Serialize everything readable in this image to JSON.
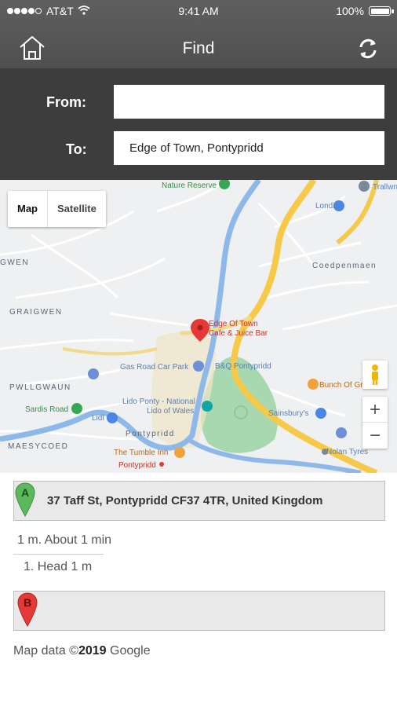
{
  "status_bar": {
    "carrier": "AT&T",
    "time": "9:41 AM",
    "battery": "100%"
  },
  "header": {
    "title": "Find",
    "home_icon": "home-icon",
    "refresh_icon": "refresh-icon"
  },
  "form": {
    "from_label": "From:",
    "from_value": "",
    "to_label": "To:",
    "to_value": "Edge of Town, Pontypridd"
  },
  "map": {
    "type_buttons": {
      "map": "Map",
      "satellite": "Satellite"
    },
    "zoom_in": "+",
    "zoom_out": "−",
    "labels": {
      "nature_reserve": "Nature Reserve",
      "trallwn": "Trallwn",
      "londis": "Londis",
      "coedpenmaen": "Coedpenmaen",
      "gwen": "GWEN",
      "graigwen": "GRAIGWEN",
      "pwllgwaun": "PWLLGWAUN",
      "maesycoed": "MAESYCOED",
      "edge_of_town_1": "Edge Of Town",
      "edge_of_town_2": "Cafe & Juice Bar",
      "gas_road": "Gas Road Car Park",
      "bq": "B&Q Pontypridd",
      "bunch": "Bunch Of Grapes",
      "sardis": "Sardis Road",
      "lido_1": "Lido Ponty - National",
      "lido_2": "Lido of Wales",
      "sainsburys": "Sainsbury's",
      "lidl": "Lidl",
      "pontypridd": "Pontypridd",
      "tumble_inn": "The Tumble Inn",
      "pontypridd_station": "Pontypridd",
      "nolan_tyres": "Nolan Tyres"
    },
    "colors": {
      "river": "#8fb8ea",
      "main_road": "#f7c948",
      "park": "#a8d8b0",
      "water_blue": "#79a9e6"
    }
  },
  "directions": {
    "start_marker": "A",
    "start_address": "37 Taff St, Pontypridd CF37 4TR, United Kingdom",
    "summary": "1 m. About 1 min",
    "steps": [
      "1. Head 1 m"
    ],
    "end_marker": "B",
    "end_address": ""
  },
  "attribution": {
    "prefix": "Map data ©",
    "year": "2019",
    "provider": " Google"
  }
}
